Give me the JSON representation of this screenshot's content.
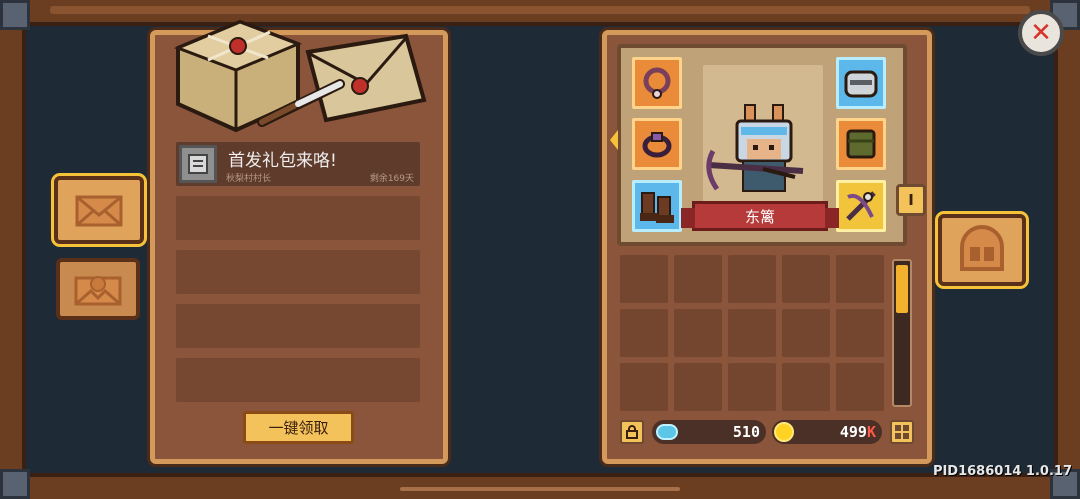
{
  "mail": {
    "items": [
      {
        "title": "首发礼包来咯!",
        "sender": "秋梨村村长",
        "remaining": "剩余169天"
      }
    ],
    "claim_all_label": "一键领取"
  },
  "character": {
    "name": "东篱",
    "level_tab": "I"
  },
  "currency": {
    "gems": "510",
    "coins": "499",
    "coins_suffix": "K"
  },
  "footer": {
    "pid": "PID1686014 1.0.17"
  },
  "icons": {
    "close": "close-icon",
    "mail_tab": "envelope-icon",
    "system_mail_tab": "seal-envelope-icon",
    "equipment_tab": "helmet-icon",
    "lock": "lock-icon",
    "menu": "grid-menu-icon",
    "gem": "gem-icon",
    "coin": "coin-icon"
  },
  "colors": {
    "accent_gold": "#f6c23a",
    "banner_red": "#b63a3a",
    "panel_wood": "#8a553a",
    "close_red": "#d8332a"
  }
}
